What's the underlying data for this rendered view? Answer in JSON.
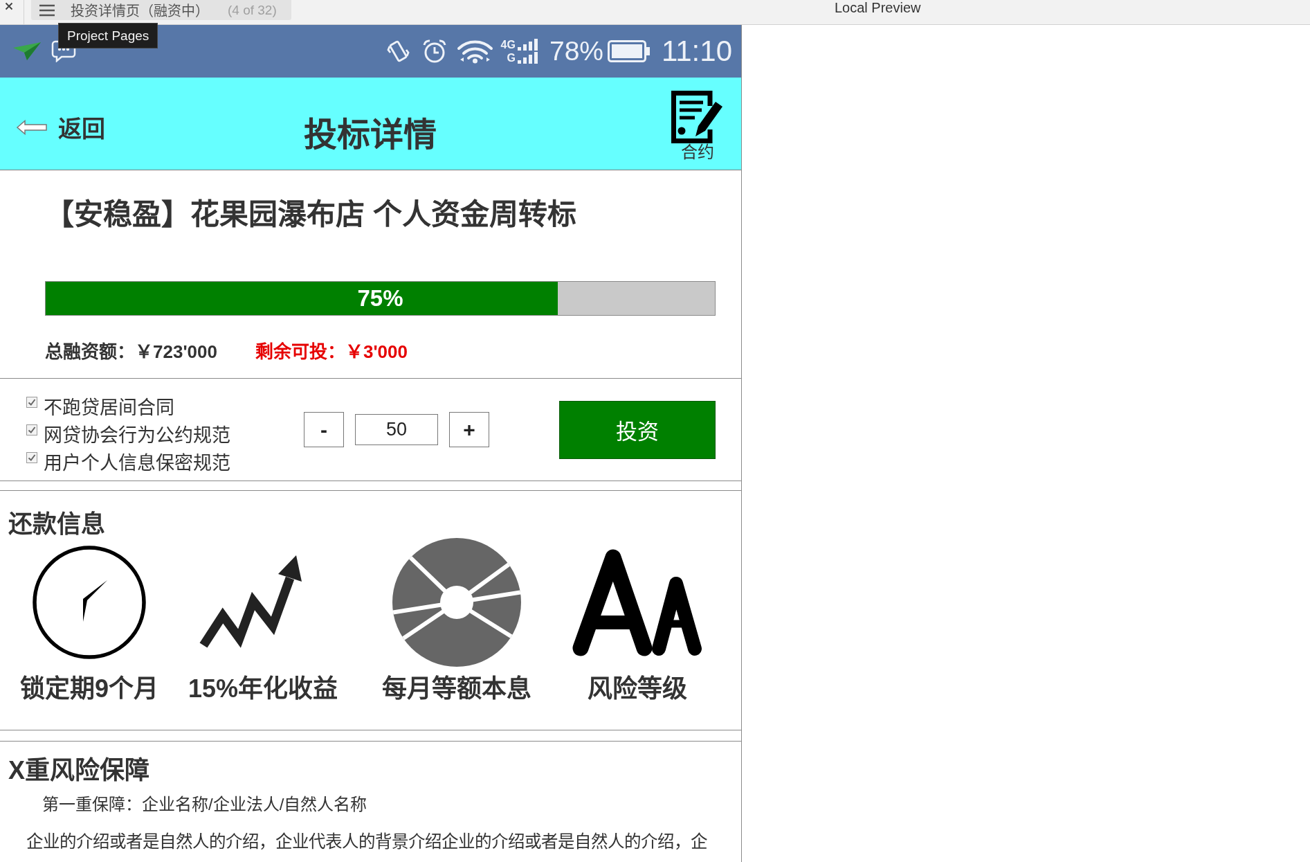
{
  "browser": {
    "tab_title": "投资详情页（融资中）",
    "tab_count": "(4 of 32)",
    "title": "Local Preview",
    "tooltip": "Project Pages"
  },
  "status_bar": {
    "networks": [
      "4G",
      "G"
    ],
    "battery": "78%",
    "time": "11:10"
  },
  "header": {
    "back": "返回",
    "title": "投标详情",
    "action": "合约"
  },
  "project": {
    "title": "【安稳盈】花果园瀑布店 个人资金周转标",
    "progress": {
      "level": 0.765,
      "label": "75%"
    },
    "total": "总融资额：￥723'000",
    "remaining": "剩余可投：￥3'000"
  },
  "agreements": [
    {
      "label": "不跑贷居间合同",
      "checked": true
    },
    {
      "label": "网贷协会行为公约规范",
      "checked": true
    },
    {
      "label": "用户个人信息保密规范",
      "checked": true
    }
  ],
  "stepper": {
    "minus": "-",
    "value": "50",
    "plus": "+"
  },
  "invest_button": "投资",
  "repayment": {
    "title": "还款信息",
    "items": [
      {
        "kind": "clock",
        "label": "锁定期9个月"
      },
      {
        "kind": "trend",
        "label": "15%年化收益"
      },
      {
        "kind": "pie",
        "label": "每月等额本息"
      },
      {
        "kind": "letters",
        "label": "风险等级"
      }
    ]
  },
  "guarantee": {
    "title": "X重风险保障",
    "subtitle": "第一重保障：企业名称/企业法人/自然人名称",
    "paragraph": "企业的介绍或者是自然人的介绍，企业代表人的背景介绍企业的介绍或者是自然人的介绍，企"
  }
}
